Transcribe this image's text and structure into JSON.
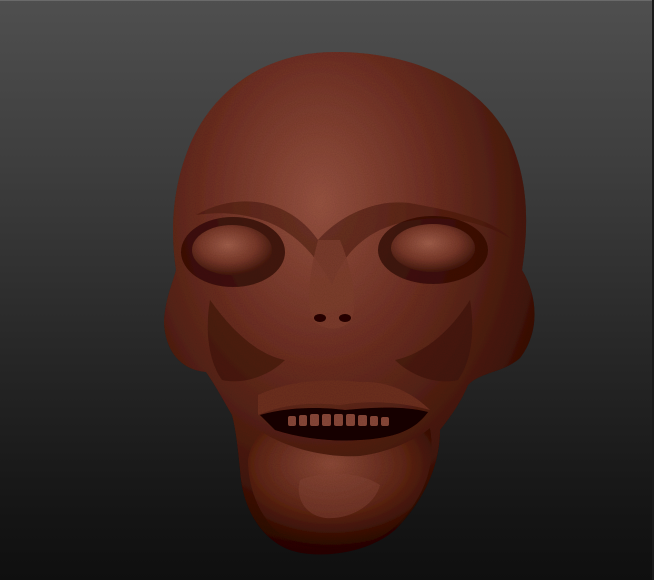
{
  "viewport": {
    "background_top": "#4f4f4f",
    "background_bottom": "#0f0f0f"
  },
  "model": {
    "subject": "alien-skull-sculpt",
    "material_color": "#6e3024",
    "material_highlight": "#9a5543",
    "material_shadow": "#2a0f0b"
  }
}
